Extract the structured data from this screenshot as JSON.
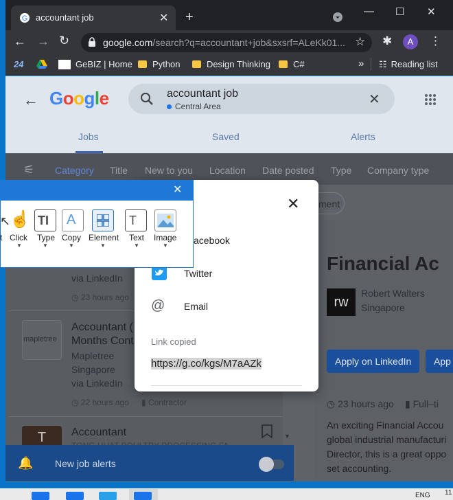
{
  "browser": {
    "tab_title": "accountant job",
    "tab_close": "✕",
    "new_tab": "+",
    "url_main": "google.com",
    "url_rest": "/search?q=accountant+job&sxsrf=ALeKk01...",
    "profile_initial": "A",
    "bookmarks": [
      "24",
      "GeBIZ | Home",
      "Python",
      "Design Thinking",
      "C#"
    ],
    "bookmarks_more": "»",
    "reading_list": "Reading list"
  },
  "google": {
    "logo": [
      "G",
      "o",
      "o",
      "g",
      "l",
      "e"
    ],
    "search_query": "accountant job",
    "search_location": "Central Area",
    "tabs": [
      "Jobs",
      "Saved",
      "Alerts"
    ],
    "filters": [
      "Category",
      "Title",
      "New to you",
      "Location",
      "Date posted",
      "Type",
      "Company type"
    ],
    "chip_partial": "ment"
  },
  "jobs": [
    {
      "via": "via LinkedIn",
      "age": "23 hours ago"
    },
    {
      "logo": "mapletree",
      "title1": "Accountant (",
      "title2": "Months Cont",
      "company": "Mapletree",
      "location": "Singapore",
      "via": "via LinkedIn",
      "age": "22 hours ago",
      "type": "Contractor"
    },
    {
      "logo": "T",
      "title": "Accountant",
      "company": "TONG HUAT POULTRY PROCESSING FA"
    }
  ],
  "detail": {
    "title": "Financial Ac",
    "logo": "rw",
    "company": "Robert Walters",
    "location": "Singapore",
    "apply_linkedin": "Apply on LinkedIn",
    "apply_partial": "App",
    "age": "23 hours ago",
    "type_partial": "Full–ti",
    "desc": [
      "An exciting Financial Accou",
      "global industrial manufacturi",
      "Director, this is a great oppo",
      "set accounting."
    ]
  },
  "alerts_bar": {
    "label": "New job alerts"
  },
  "share": {
    "facebook": "acebook",
    "twitter": "Twitter",
    "email": "Email",
    "link_copied": "Link copied",
    "link_url": "https://g.co/kgs/M7aAZk"
  },
  "snip": {
    "tools": [
      "t",
      "Click",
      "Type",
      "Copy",
      "Element",
      "Text",
      "Image"
    ]
  },
  "taskbar": {
    "lang": "ENG",
    "time": "11"
  }
}
